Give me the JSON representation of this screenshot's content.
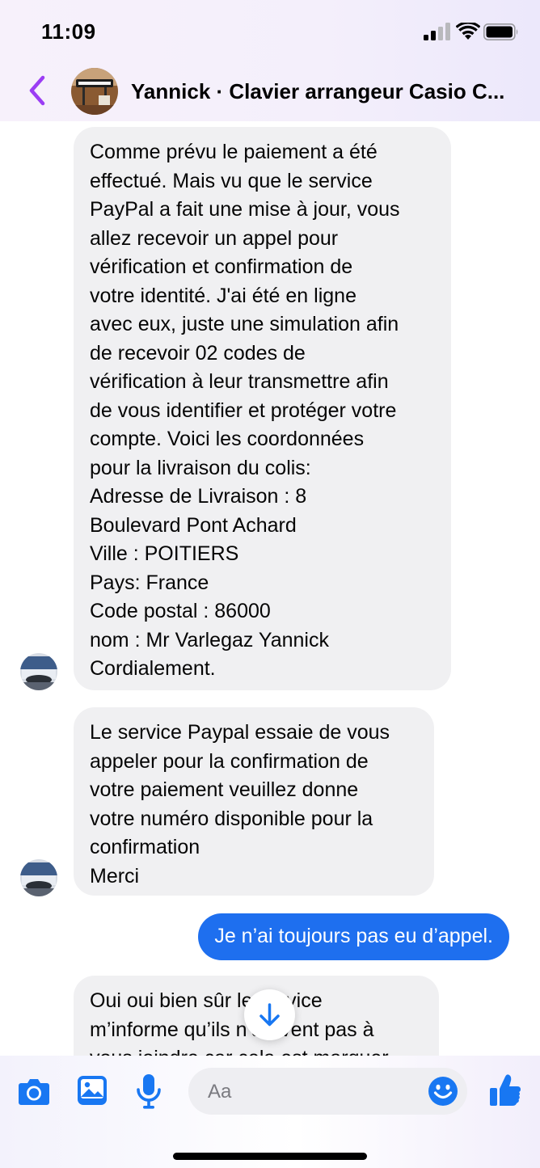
{
  "status_bar": {
    "time": "11:09",
    "icons": [
      "cellular-signal-icon",
      "wifi-icon",
      "battery-icon"
    ]
  },
  "header": {
    "title": "Yannick · Clavier arrangeur Casio C...",
    "back_icon": "chevron-left-icon",
    "accent_color": "#9b3df4"
  },
  "messages": [
    {
      "direction": "incoming",
      "text": "Comme prévu le paiement a été\neffectué. Mais vu que le service\nPayPal a fait une mise à jour, vous\nallez recevoir  un appel pour\nvérification et confirmation de\nvotre identité. J'ai été en ligne\navec eux, juste une simulation afin\nde recevoir 02 codes de\nvérification à leur transmettre afin\nde vous identifier et protéger votre\ncompte. Voici les coordonnées\npour la livraison du colis:\nAdresse de Livraison :  8\nBoulevard Pont Achard\nVille : POITIERS\nPays: France\nCode postal : 86000\nnom : Mr Varlegaz Yannick\nCordialement."
    },
    {
      "direction": "incoming",
      "text": "Le service Paypal essaie de vous\nappeler pour la confirmation de\nvotre paiement veuillez donne\nvotre numéro disponible pour la\nconfirmation\nMerci"
    },
    {
      "direction": "outgoing",
      "text": "Je n’ai toujours pas eu d’appel."
    },
    {
      "direction": "incoming",
      "text": "Oui oui bien sûr le service\nm’informe qu’ils n’arrivent pas à\nvous joindre car cela est marquer"
    }
  ],
  "scroll_down_icon": "arrow-down-icon",
  "composer": {
    "placeholder": "Aa",
    "icons": [
      "camera-icon",
      "photo-gallery-icon",
      "microphone-icon",
      "emoji-icon",
      "thumbs-up-icon"
    ],
    "accent_color": "#1877f2"
  },
  "colors": {
    "incoming_bubble": "#f0f0f2",
    "outgoing_bubble": "#1e6fef"
  }
}
